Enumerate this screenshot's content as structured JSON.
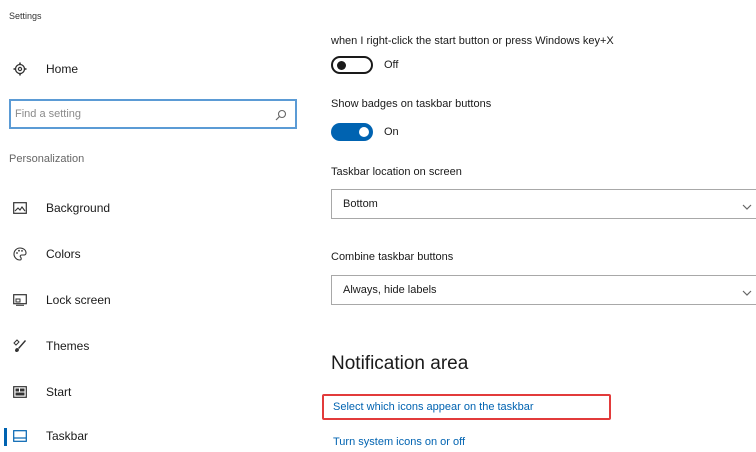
{
  "app": {
    "title": "Settings"
  },
  "sidebar": {
    "home_label": "Home",
    "search_placeholder": "Find a setting",
    "section_label": "Personalization",
    "items": [
      {
        "label": "Background",
        "icon": "picture-icon"
      },
      {
        "label": "Colors",
        "icon": "palette-icon"
      },
      {
        "label": "Lock screen",
        "icon": "lock-screen-icon"
      },
      {
        "label": "Themes",
        "icon": "brush-icon"
      },
      {
        "label": "Start",
        "icon": "start-icon"
      },
      {
        "label": "Taskbar",
        "icon": "taskbar-icon",
        "selected": true
      }
    ]
  },
  "content": {
    "replace_cmd_text": "when I right-click the start button or press Windows key+X",
    "replace_cmd_toggle": {
      "state": "Off",
      "on": false
    },
    "badges_label": "Show badges on taskbar buttons",
    "badges_toggle": {
      "state": "On",
      "on": true
    },
    "location_label": "Taskbar location on screen",
    "location_value": "Bottom",
    "combine_label": "Combine taskbar buttons",
    "combine_value": "Always, hide labels",
    "notification_heading": "Notification area",
    "link_select_icons": "Select which icons appear on the taskbar",
    "link_system_icons": "Turn system icons on or off"
  },
  "colors": {
    "accent": "#0063b1",
    "highlight": "#e23b3b",
    "search_border": "#5b9bd5"
  }
}
